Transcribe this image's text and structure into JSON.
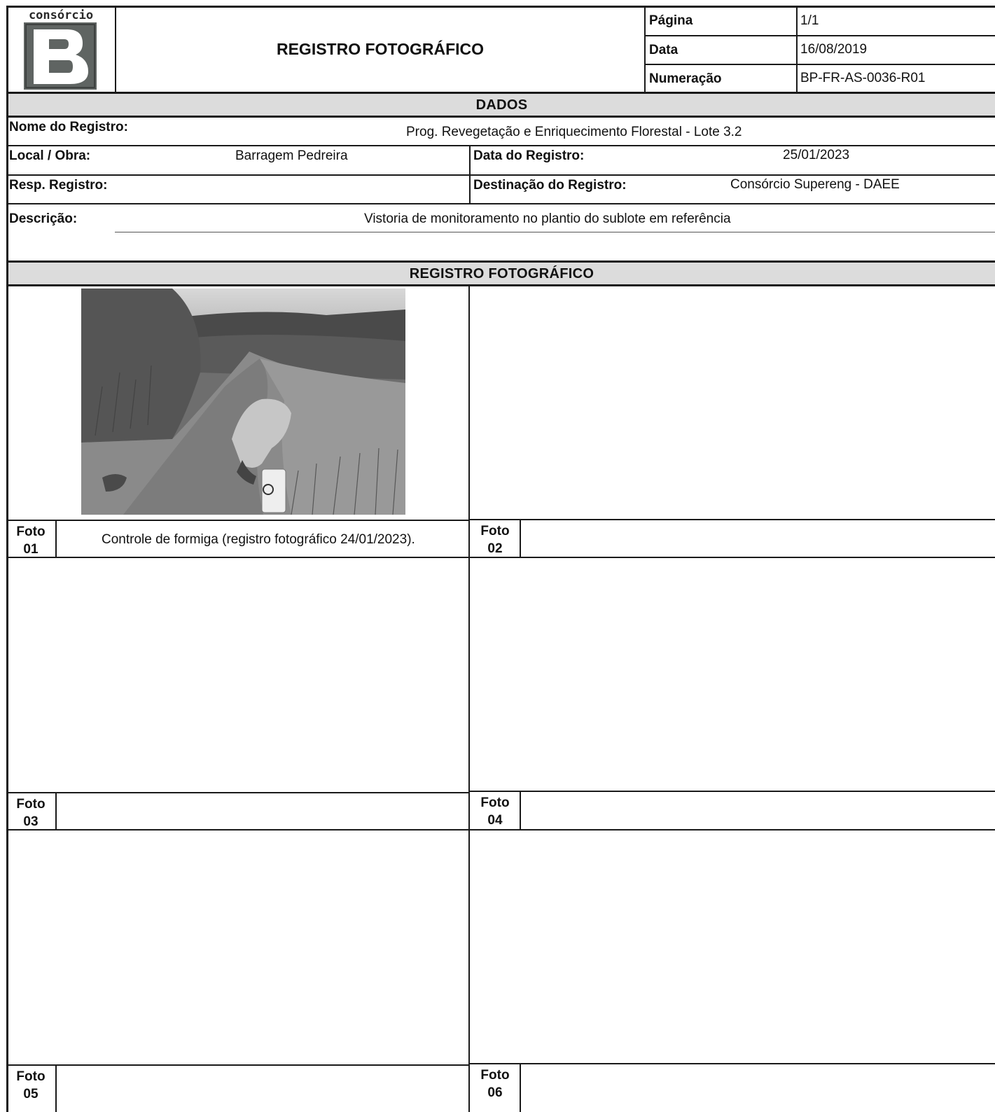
{
  "header": {
    "logo_text": "consórcio",
    "logo_letter": "B",
    "title": "REGISTRO FOTOGRÁFICO",
    "meta": [
      {
        "label": "Página",
        "value": "1/1"
      },
      {
        "label": "Data",
        "value": "16/08/2019"
      },
      {
        "label": "Numeração",
        "value": "BP-FR-AS-0036-R01"
      }
    ]
  },
  "dados": {
    "heading": "DADOS",
    "nome_label": "Nome do Registro:",
    "nome_value": "Prog. Revegetação e Enriquecimento Florestal - Lote 3.2",
    "local_label": "Local / Obra:",
    "local_value": "Barragem Pedreira",
    "data_registro_label": "Data do Registro:",
    "data_registro_value": "25/01/2023",
    "resp_label": "Resp. Registro:",
    "resp_value": "",
    "destinacao_label": "Destinação do Registro:",
    "destinacao_value": "Consórcio Supereng - DAEE",
    "descricao_label": "Descrição:",
    "descricao_value": "Vistoria de monitoramento no plantio do sublote em referência"
  },
  "registro": {
    "heading": "REGISTRO FOTOGRÁFICO",
    "fotos": [
      {
        "word": "Foto",
        "num": "01",
        "caption": "Controle de formiga  (registro fotográfico 24/01/2023)."
      },
      {
        "word": "Foto",
        "num": "02",
        "caption": ""
      },
      {
        "word": "Foto",
        "num": "03",
        "caption": ""
      },
      {
        "word": "Foto",
        "num": "04",
        "caption": ""
      },
      {
        "word": "Foto",
        "num": "05",
        "caption": ""
      },
      {
        "word": "Foto",
        "num": "06",
        "caption": ""
      }
    ]
  },
  "colors": {
    "band_gray": "#dcdcdc",
    "logo_gray": "#5f6462",
    "line": "#1a1a1a"
  }
}
